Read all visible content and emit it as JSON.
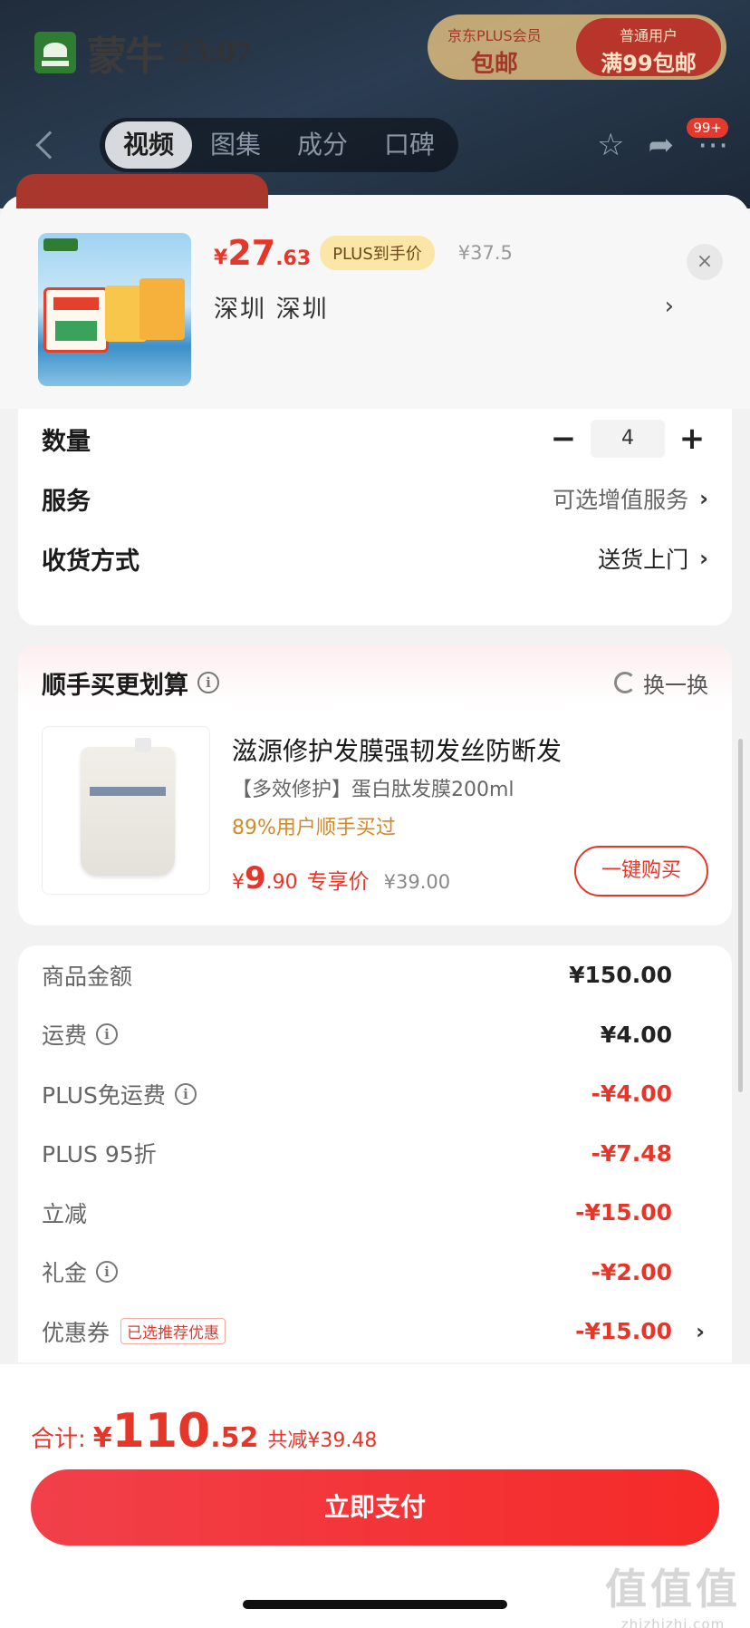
{
  "background": {
    "brand": "蒙牛",
    "brand_sub": "23:07",
    "promo_left_title": "京东PLUS会员",
    "promo_left_value": "包邮",
    "promo_right_title": "普通用户",
    "promo_right_value": "满99包邮",
    "tabs": [
      "视频",
      "图集",
      "成分",
      "口碑"
    ],
    "active_tab": 0,
    "badge": "99+"
  },
  "header": {
    "price_currency": "¥",
    "price_integer": "27",
    "price_decimal": ".63",
    "plus_tag": "PLUS到手价",
    "original_price": "¥37.5",
    "location": "深圳  深圳",
    "close_glyph": "×"
  },
  "options": {
    "quantity_label": "数量",
    "quantity_value": "4",
    "minus": "−",
    "plus": "+",
    "service_label": "服务",
    "service_value": "可选增值服务",
    "delivery_label": "收货方式",
    "delivery_value": "送货上门"
  },
  "addon": {
    "title": "顺手买更划算",
    "swap_label": "换一换",
    "product_name": "滋源修护发膜强韧发丝防断发",
    "product_sub": "【多效修护】蛋白肽发膜200ml",
    "popularity": "89%用户顺手买过",
    "price_currency": "¥",
    "price_integer": "9",
    "price_decimal": ".90",
    "price_tag": "专享价",
    "original_price": "¥39.00",
    "buy_button": "一键购买"
  },
  "summary": {
    "rows": [
      {
        "label": "商品金额",
        "value": "¥150.00",
        "info": false,
        "red": false
      },
      {
        "label": "运费",
        "value": "¥4.00",
        "info": true,
        "red": false
      },
      {
        "label": "PLUS免运费",
        "value": "-¥4.00",
        "info": true,
        "red": true
      },
      {
        "label": "PLUS 95折",
        "value": "-¥7.48",
        "info": false,
        "red": true
      },
      {
        "label": "立减",
        "value": "-¥15.00",
        "info": false,
        "red": true
      },
      {
        "label": "礼金",
        "value": "-¥2.00",
        "info": true,
        "red": true
      },
      {
        "label": "优惠券",
        "value": "-¥15.00",
        "info": false,
        "red": true,
        "tag": "已选推荐优惠",
        "chevron": true
      }
    ]
  },
  "footer": {
    "total_label": "合计:",
    "total_currency": "¥",
    "total_integer": "110",
    "total_decimal": ".52",
    "total_savings": "共减¥39.48",
    "pay_button": "立即支付"
  },
  "watermark": {
    "big": "值值值",
    "small": "zhizhizhi.com"
  },
  "colors": {
    "accent": "#e6362a",
    "plus_tag_bg": "#fbe6a8",
    "popularity": "#d08a2c"
  }
}
